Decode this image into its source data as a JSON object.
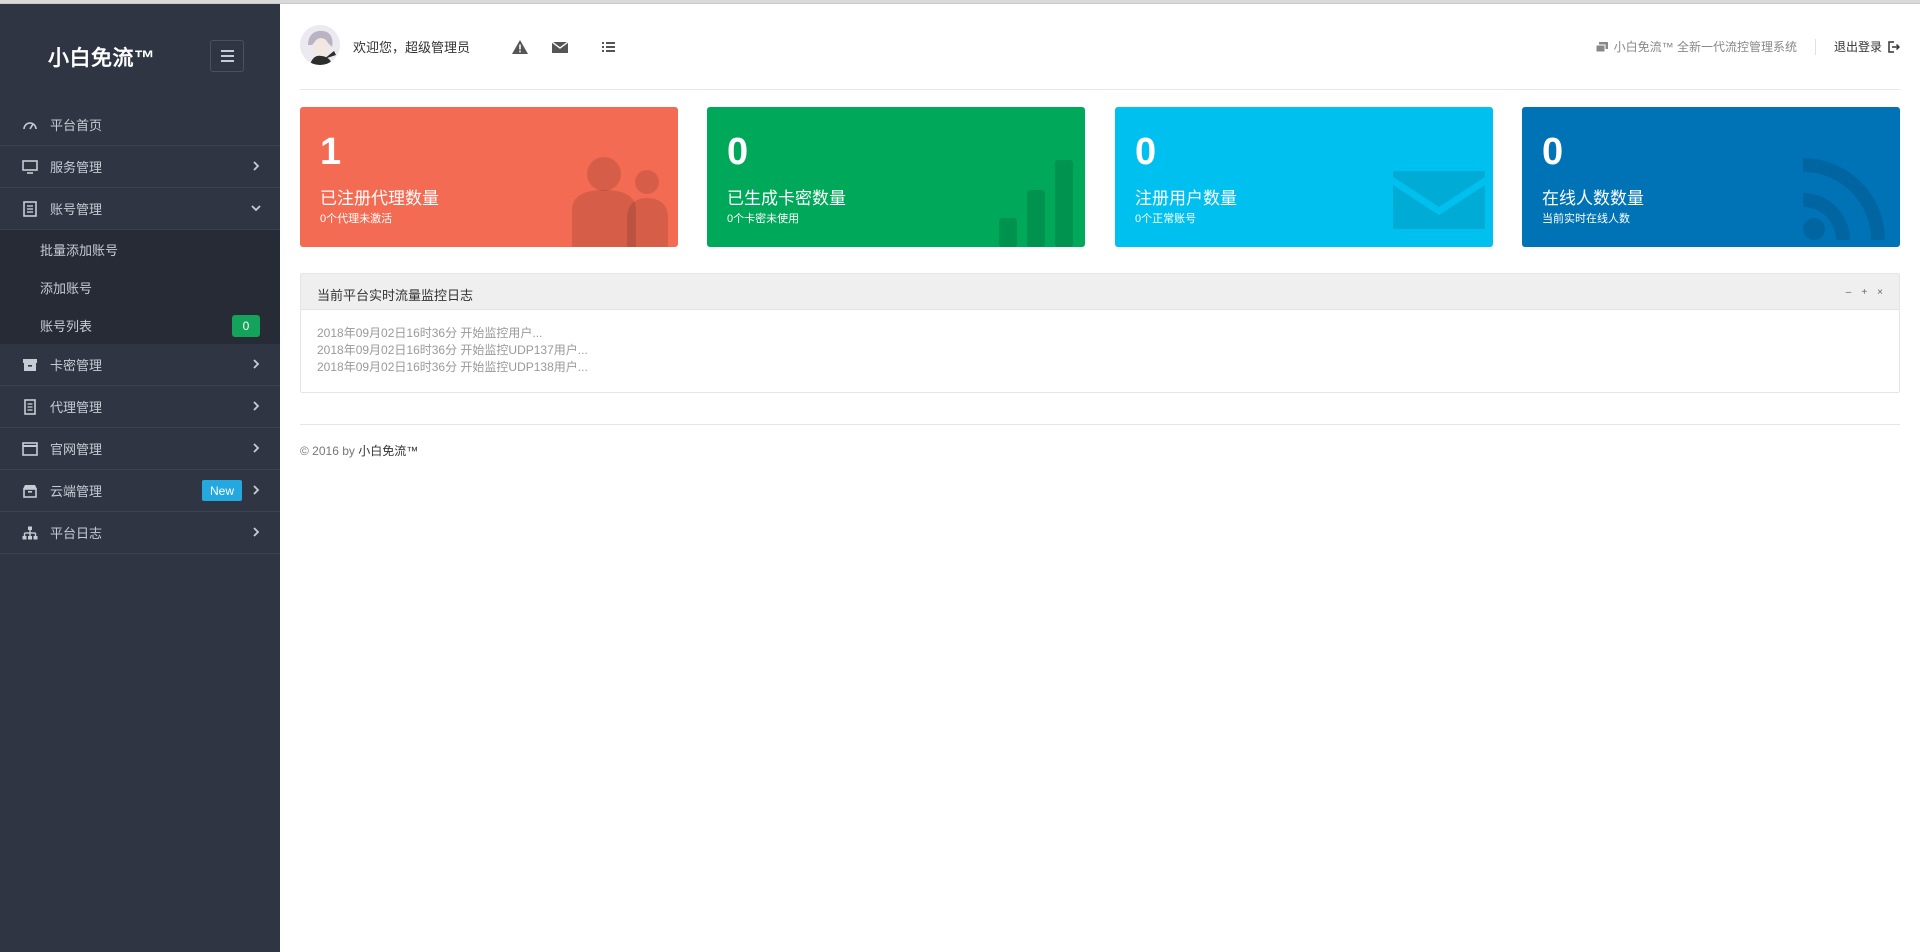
{
  "brand": {
    "title": "小白免流™"
  },
  "sidebar": {
    "items": [
      {
        "label": "平台首页",
        "icon": "dashboard-icon"
      },
      {
        "label": "服务管理",
        "icon": "monitor-icon"
      },
      {
        "label": "账号管理",
        "icon": "document-icon",
        "expanded": true,
        "sub": [
          {
            "label": "批量添加账号"
          },
          {
            "label": "添加账号"
          },
          {
            "label": "账号列表",
            "badge": "0"
          }
        ]
      },
      {
        "label": "卡密管理",
        "icon": "archive-icon"
      },
      {
        "label": "代理管理",
        "icon": "list-doc-icon"
      },
      {
        "label": "官网管理",
        "icon": "window-icon"
      },
      {
        "label": "云端管理",
        "icon": "box-icon",
        "badge": "New"
      },
      {
        "label": "平台日志",
        "icon": "sitemap-icon"
      }
    ]
  },
  "header": {
    "welcome": "欢迎您，超级管理员",
    "system_name": "小白免流™ 全新一代流控管理系统",
    "logout": "退出登录"
  },
  "cards": [
    {
      "value": "1",
      "title": "已注册代理数量",
      "sub": "0个代理未激活",
      "color": "#f46b54",
      "icon": "users-icon"
    },
    {
      "value": "0",
      "title": "已生成卡密数量",
      "sub": "0个卡密未使用",
      "color": "#00a85a",
      "icon": "bar-chart-icon"
    },
    {
      "value": "0",
      "title": "注册用户数量",
      "sub": "0个正常账号",
      "color": "#00c0ef",
      "icon": "envelope-icon"
    },
    {
      "value": "0",
      "title": "在线人数数量",
      "sub": "当前实时在线人数",
      "color": "#0073b7",
      "icon": "rss-icon"
    }
  ],
  "panel": {
    "title": "当前平台实时流量监控日志",
    "tools": [
      "–",
      "+",
      "×"
    ],
    "lines": [
      "2018年09月02日16时36分 开始监控用户...",
      "2018年09月02日16时36分 开始监控UDP137用户...",
      "2018年09月02日16时36分 开始监控UDP138用户..."
    ]
  },
  "footer": {
    "prefix": "© 2016 by",
    "brand": "小白免流™"
  }
}
